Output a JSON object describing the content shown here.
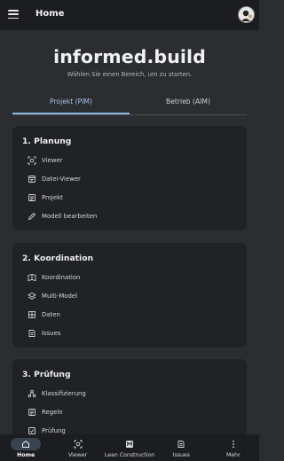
{
  "topbar": {
    "title": "Home",
    "menu_icon": "menu-icon",
    "avatar_icon": "user-avatar"
  },
  "hero": {
    "brand": "informed.build",
    "subtitle": "Wählen Sie einen Bereich, um zu starten."
  },
  "tabs": [
    {
      "label": "Projekt (PIM)",
      "active": true
    },
    {
      "label": "Betrieb (AIM)",
      "active": false
    }
  ],
  "sections": [
    {
      "title": "1. Planung",
      "items": [
        {
          "label": "Viewer",
          "icon": "viewer-icon"
        },
        {
          "label": "Datei-Viewer",
          "icon": "file-viewer-icon"
        },
        {
          "label": "Projekt",
          "icon": "project-icon"
        },
        {
          "label": "Modell bearbeiten",
          "icon": "pencil-icon"
        }
      ]
    },
    {
      "title": "2. Koordination",
      "items": [
        {
          "label": "Koordination",
          "icon": "coordination-icon"
        },
        {
          "label": "Multi-Model",
          "icon": "layers-icon"
        },
        {
          "label": "Daten",
          "icon": "data-grid-icon"
        },
        {
          "label": "Issues",
          "icon": "issues-icon"
        }
      ]
    },
    {
      "title": "3. Prüfung",
      "items": [
        {
          "label": "Klassifizierung",
          "icon": "classification-icon"
        },
        {
          "label": "Regeln",
          "icon": "rules-icon"
        },
        {
          "label": "Prüfung",
          "icon": "check-icon"
        }
      ]
    }
  ],
  "bottom_nav": [
    {
      "label": "Home",
      "icon": "home-icon",
      "active": true
    },
    {
      "label": "Viewer",
      "icon": "viewer-icon",
      "active": false
    },
    {
      "label": "Lean Construction",
      "icon": "lean-construction-icon",
      "active": false
    },
    {
      "label": "Issues",
      "icon": "issues-icon",
      "active": false
    },
    {
      "label": "Mehr",
      "icon": "more-icon",
      "active": false
    }
  ],
  "colors": {
    "background": "#2b2d30",
    "bar": "#1c1d20",
    "card": "#212225",
    "accent": "#8fb6e6"
  }
}
